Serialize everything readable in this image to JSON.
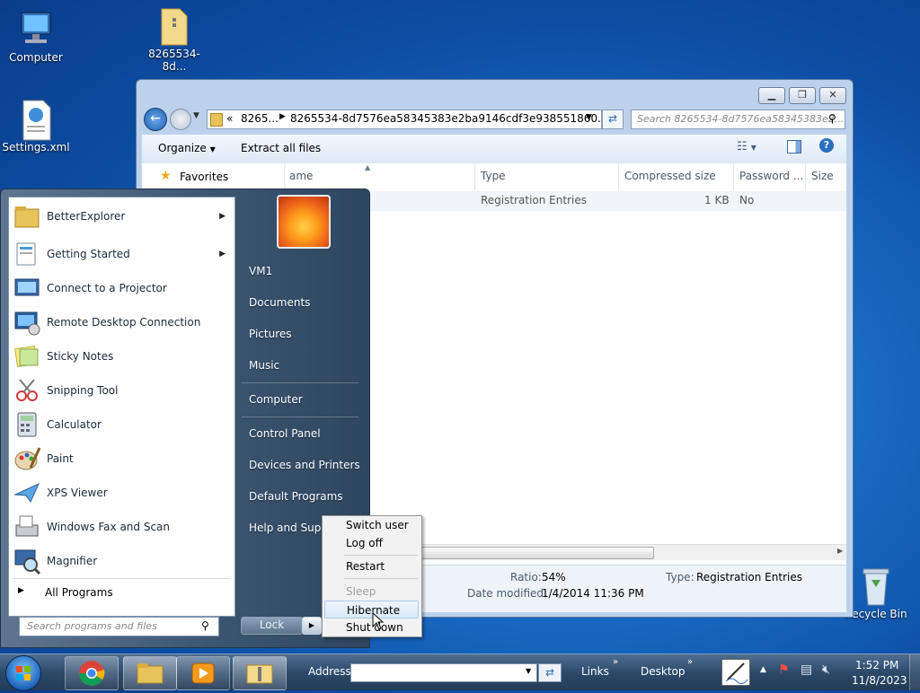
{
  "desktop": {
    "icons": [
      {
        "label": "Computer"
      },
      {
        "label": "8265534-8d..."
      },
      {
        "label": "Settings.xml"
      },
      {
        "label": "Recycle Bin"
      }
    ]
  },
  "explorer": {
    "breadcrumb_prefix": "«",
    "breadcrumb_1": "8265...",
    "breadcrumb_2": "8265534-8d7576ea58345383e2ba9146cdf3e938551860...",
    "search_placeholder": "Search 8265534-8d7576ea58345383e2...",
    "toolbar": {
      "organize": "Organize",
      "extract_all": "Extract all files"
    },
    "nav_favorites": "Favorites",
    "columns": [
      "ame",
      "Type",
      "Compressed size",
      "Password ...",
      "Size"
    ],
    "row": {
      "type": "Registration Entries",
      "compressed": "1 KB",
      "password": "No"
    },
    "details": {
      "ratio_label": "Ratio:",
      "ratio_value": "54%",
      "date_label": "Date modified:",
      "date_value": "1/4/2014 11:36 PM",
      "type_label": "Type:",
      "type_value": "Registration Entries"
    }
  },
  "start_menu": {
    "programs": [
      {
        "label": "BetterExplorer",
        "submenu": true
      },
      {
        "label": "Getting Started",
        "submenu": true
      },
      {
        "label": "Connect to a Projector"
      },
      {
        "label": "Remote Desktop Connection"
      },
      {
        "label": "Sticky Notes"
      },
      {
        "label": "Snipping Tool"
      },
      {
        "label": "Calculator"
      },
      {
        "label": "Paint"
      },
      {
        "label": "XPS Viewer"
      },
      {
        "label": "Windows Fax and Scan"
      },
      {
        "label": "Magnifier"
      }
    ],
    "all_programs": "All Programs",
    "search_placeholder": "Search programs and files",
    "right_items": [
      "VM1",
      "Documents",
      "Pictures",
      "Music",
      "Computer",
      "Control Panel",
      "Devices and Printers",
      "Default Programs",
      "Help and Suppo"
    ],
    "lock_label": "Lock",
    "power_menu": [
      "Switch user",
      "Log off",
      "Restart",
      "Sleep",
      "Hibernate",
      "Shut down"
    ]
  },
  "taskbar": {
    "address_label": "Address",
    "links_label": "Links",
    "desktop_label": "Desktop",
    "time": "1:52 PM",
    "date": "11/8/2023"
  }
}
